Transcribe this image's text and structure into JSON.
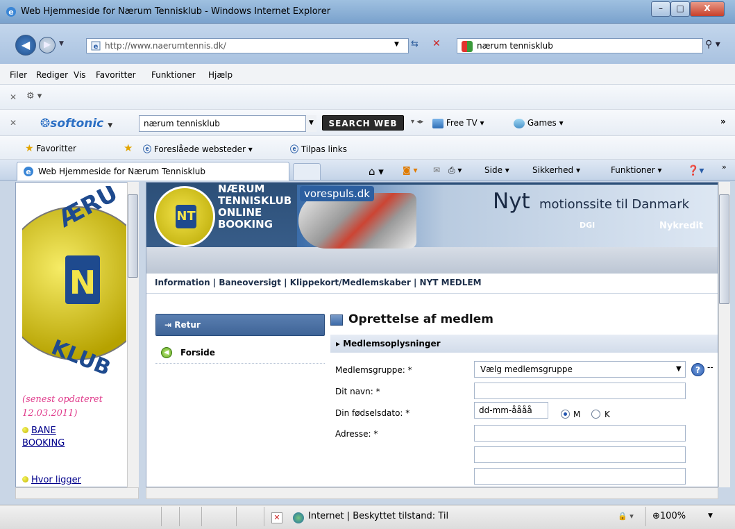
{
  "window": {
    "title": "Web Hjemmeside for Nærum Tennisklub - Windows Internet Explorer",
    "buttons": {
      "min": "–",
      "max": "□",
      "close": "X"
    }
  },
  "addressbar": {
    "url": "http://www.naerumtennis.dk/",
    "search_value": "nærum tennisklub"
  },
  "menubar": {
    "items": [
      "Filer",
      "Rediger",
      "Vis",
      "Favoritter",
      "Funktioner",
      "Hjælp"
    ]
  },
  "toolbar_softonic": {
    "brand": "softonic",
    "search_value": "nærum tennisklub",
    "search_button": "SEARCH WEB",
    "freetv": "Free TV",
    "games": "Games"
  },
  "favorites_bar": {
    "favorites": "Favoritter",
    "suggested": "Foreslåede websteder",
    "links": "Tilpas links"
  },
  "tab": {
    "title": "Web Hjemmeside for Nærum Tennisklub"
  },
  "commandbar": {
    "side": "Side",
    "security": "Sikkerhed",
    "tools": "Funktioner"
  },
  "leftframe": {
    "updated_line1": "(senest opdateret",
    "updated_line2": "12.03.2011)",
    "link1_line1": "BANE",
    "link1_line2": "BOOKING",
    "link2": "Hvor ligger"
  },
  "banner": {
    "logo_text": "NT",
    "title_lines": [
      "NÆRUM",
      "TENNISKLUB",
      "ONLINE",
      "BOOKING"
    ],
    "ad_logo": "vorespuls.dk",
    "ad_headline_big": "Nyt",
    "ad_headline_rest": "motionssite til Danmark",
    "ad_sponsor1": "DGI",
    "ad_sponsor2": "Nykredit"
  },
  "navlinks": "Information | Baneoversigt | Klippekort/Medlemskaber | NYT MEDLEM",
  "sidenav": {
    "retur": "Retur",
    "forside": "Forside"
  },
  "form": {
    "title": "Oprettelse af medlem",
    "section": "Medlemsoplysninger",
    "labels": {
      "group": "Medlemsgruppe: *",
      "name": "Dit navn: *",
      "dob": "Din fødselsdato: *",
      "address": "Adresse: *"
    },
    "group_selected": "Vælg medlemsgruppe",
    "dob_value": "dd-mm-åååå",
    "gender_m": "M",
    "gender_k": "K",
    "help_dash": "--"
  },
  "statusbar": {
    "zone": "Internet | Beskyttet tilstand: Til",
    "zoom": "100%"
  }
}
